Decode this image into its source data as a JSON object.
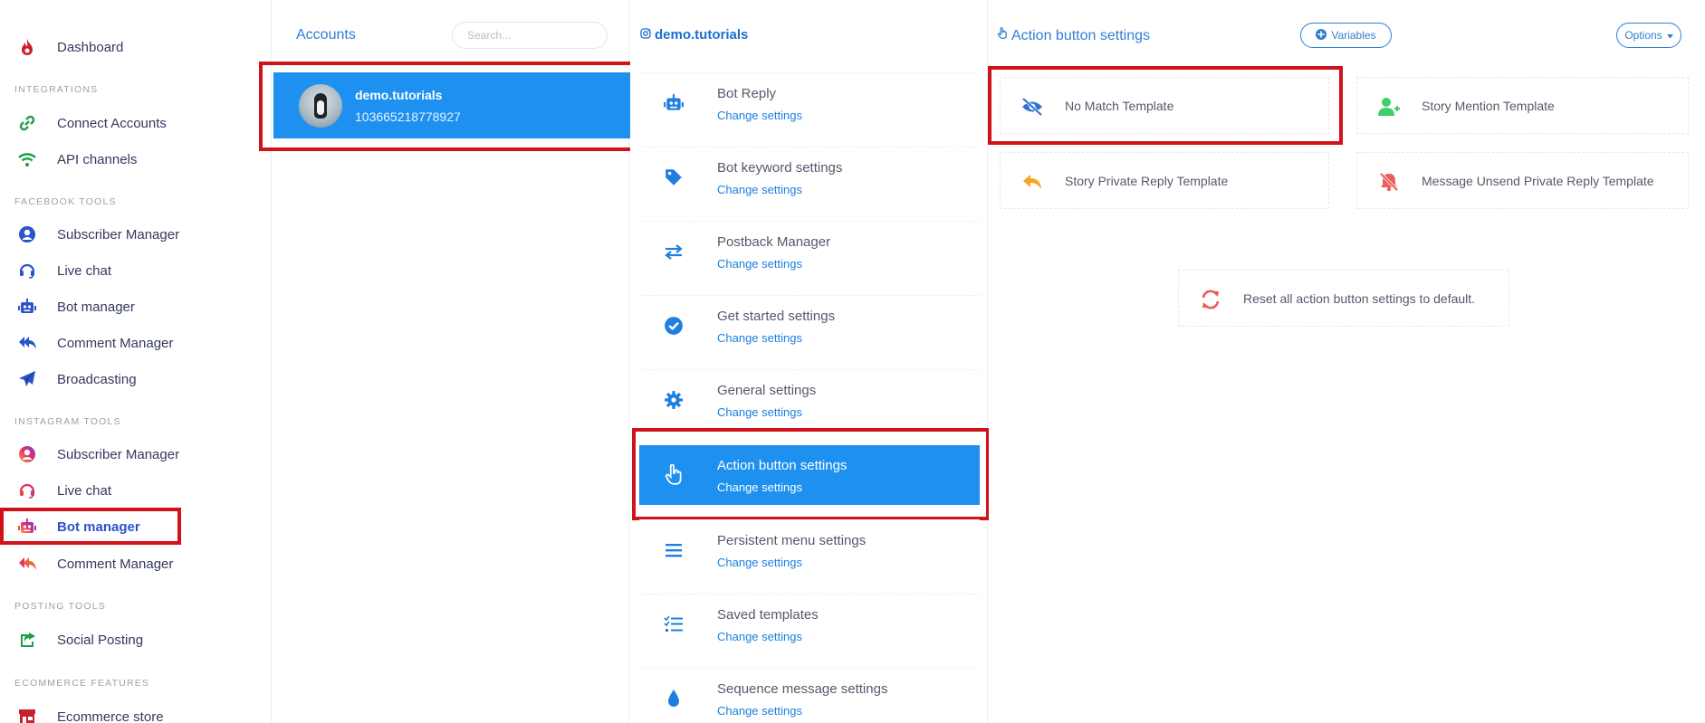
{
  "sidebar": {
    "dashboard": "Dashboard",
    "sections": {
      "integrations": "INTEGRATIONS",
      "facebook_tools": "FACEBOOK TOOLS",
      "instagram_tools": "INSTAGRAM TOOLS",
      "posting_tools": "POSTING TOOLS",
      "ecommerce_features": "ECOMMERCE FEATURES"
    },
    "integrations": [
      "Connect Accounts",
      "API channels"
    ],
    "facebook_tools": [
      "Subscriber Manager",
      "Live chat",
      "Bot manager",
      "Comment Manager",
      "Broadcasting"
    ],
    "instagram_tools": [
      "Subscriber Manager",
      "Live chat",
      "Bot manager",
      "Comment Manager"
    ],
    "posting_tools": [
      "Social Posting"
    ],
    "ecommerce_features": [
      "Ecommerce store"
    ]
  },
  "accounts": {
    "title": "Accounts",
    "search_placeholder": "Search...",
    "selected": {
      "name": "demo.tutorials",
      "id": "103665218778927"
    }
  },
  "menu": {
    "title": "demo.tutorials",
    "link_label": "Change settings",
    "items": [
      {
        "title": "Bot Reply",
        "icon": "robot-icon"
      },
      {
        "title": "Bot keyword settings",
        "icon": "tag-icon"
      },
      {
        "title": "Postback Manager",
        "icon": "exchange-icon"
      },
      {
        "title": "Get started settings",
        "icon": "check-circle-icon"
      },
      {
        "title": "General settings",
        "icon": "gear-icon"
      },
      {
        "title": "Action button settings",
        "icon": "hand-pointer-icon"
      },
      {
        "title": "Persistent menu settings",
        "icon": "bars-icon"
      },
      {
        "title": "Saved templates",
        "icon": "tasks-icon"
      },
      {
        "title": "Sequence message settings",
        "icon": "drop-icon"
      }
    ]
  },
  "action": {
    "title": "Action button settings",
    "variables_label": "Variables",
    "options_label": "Options",
    "templates": [
      "No Match Template",
      "Story Mention Template",
      "Story Private Reply Template",
      "Message Unsend Private Reply Template"
    ],
    "reset_label": "Reset all action button settings to default."
  },
  "colors": {
    "accent": "#1e90f0",
    "link": "#1c7fe0",
    "highlight": "#d0121b"
  }
}
